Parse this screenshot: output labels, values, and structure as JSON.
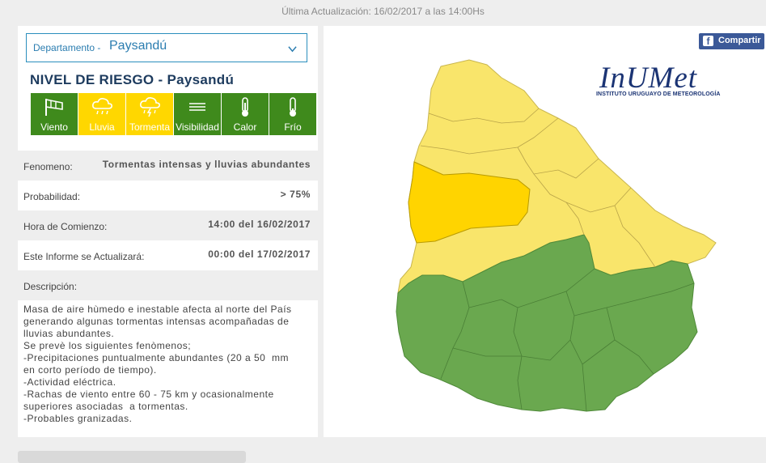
{
  "header": {
    "update_text": "Última Actualización: 16/02/2017 a las 14:00Hs"
  },
  "department": {
    "label": "Departamento -",
    "value": "Paysandú"
  },
  "risk": {
    "title": "NIVEL DE RIESGO - Paysandú",
    "items": [
      {
        "label": "Viento",
        "icon": "windsock-icon",
        "level": "green"
      },
      {
        "label": "Lluvia",
        "icon": "rain-cloud-icon",
        "level": "yellow"
      },
      {
        "label": "Tormenta",
        "icon": "storm-cloud-icon",
        "level": "yellow"
      },
      {
        "label": "Visibilidad",
        "icon": "fog-icon",
        "level": "green"
      },
      {
        "label": "Calor",
        "icon": "thermometer-icon",
        "level": "green"
      },
      {
        "label": "Frío",
        "icon": "thermometer-icon",
        "level": "green"
      }
    ]
  },
  "info": {
    "fenomeno_label": "Fenomeno:",
    "fenomeno_value": "Tormentas intensas y lluvias abundantes",
    "probabilidad_label": "Probabilidad:",
    "probabilidad_value": "> 75%",
    "comienzo_label": "Hora de Comienzo:",
    "comienzo_value": "14:00 del 16/02/2017",
    "actualizara_label": "Este Informe se Actualizará:",
    "actualizara_value": "00:00 del 17/02/2017",
    "descripcion_label": "Descripción:",
    "descripcion_text": "Masa de aire hùmedo e inestable afecta al norte del País\ngenerando algunas tormentas intensas acompañadas de\nlluvias abundantes.\nSe prevè los siguientes fenòmenos;\n-Precipitaciones puntualmente abundantes (20 a 50  mm\nen corto período de tiempo).\n-Actividad eléctrica.\n-Rachas de viento entre 60 - 75 km y ocasionalmente\nsuperiores asociadas  a tormentas.\n-Probables granizadas."
  },
  "share": {
    "label": "Compartir",
    "icon": "facebook-icon"
  },
  "logo": {
    "word": "InUMet",
    "subtitle": "INSTITUTO URUGUAYO DE METEOROLOGÍA"
  },
  "colors": {
    "green": "#3f8a1c",
    "yellow": "#ffd700",
    "map_yellow": "#f9e56b",
    "map_green": "#6aa84f",
    "map_selected": "#ffd400"
  }
}
